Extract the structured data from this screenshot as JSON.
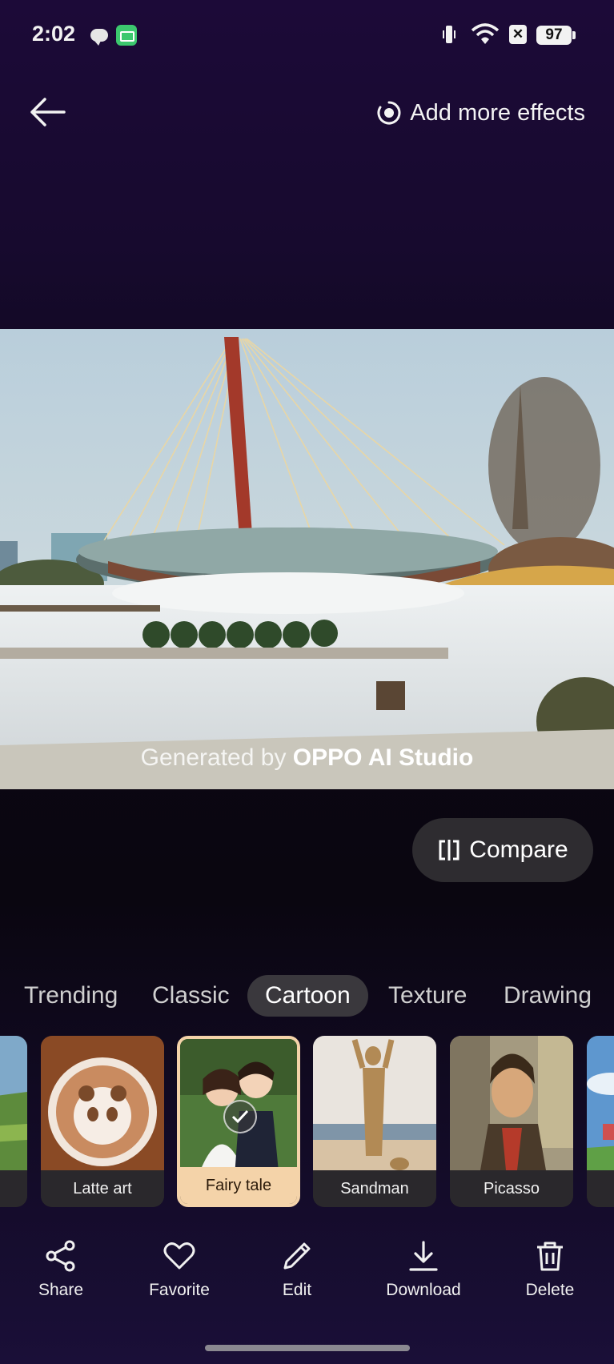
{
  "status_bar": {
    "time": "2:02",
    "battery": "97"
  },
  "header": {
    "back_icon": "arrow-left-icon",
    "add_effects_label": "Add more effects",
    "add_effects_icon": "effect-circle-icon"
  },
  "photo": {
    "watermark_prefix": "Generated by ",
    "watermark_brand": "OPPO AI Studio"
  },
  "compare": {
    "label": "Compare",
    "icon": "compare-split-icon"
  },
  "tabs": [
    {
      "label": "Trending",
      "active": false
    },
    {
      "label": "Classic",
      "active": false
    },
    {
      "label": "Cartoon",
      "active": true
    },
    {
      "label": "Texture",
      "active": false
    },
    {
      "label": "Drawing",
      "active": false
    }
  ],
  "effects": [
    {
      "label": "",
      "selected": false
    },
    {
      "label": "Latte art",
      "selected": false
    },
    {
      "label": "Fairy tale",
      "selected": true
    },
    {
      "label": "Sandman",
      "selected": false
    },
    {
      "label": "Picasso",
      "selected": false
    },
    {
      "label": "",
      "selected": false
    }
  ],
  "toolbar": [
    {
      "label": "Share",
      "icon": "share-icon"
    },
    {
      "label": "Favorite",
      "icon": "heart-icon"
    },
    {
      "label": "Edit",
      "icon": "pencil-icon"
    },
    {
      "label": "Download",
      "icon": "download-icon"
    },
    {
      "label": "Delete",
      "icon": "trash-icon"
    }
  ],
  "colors": {
    "selected_accent": "#f4d3a9",
    "active_tab_bg": "#3a383d"
  }
}
